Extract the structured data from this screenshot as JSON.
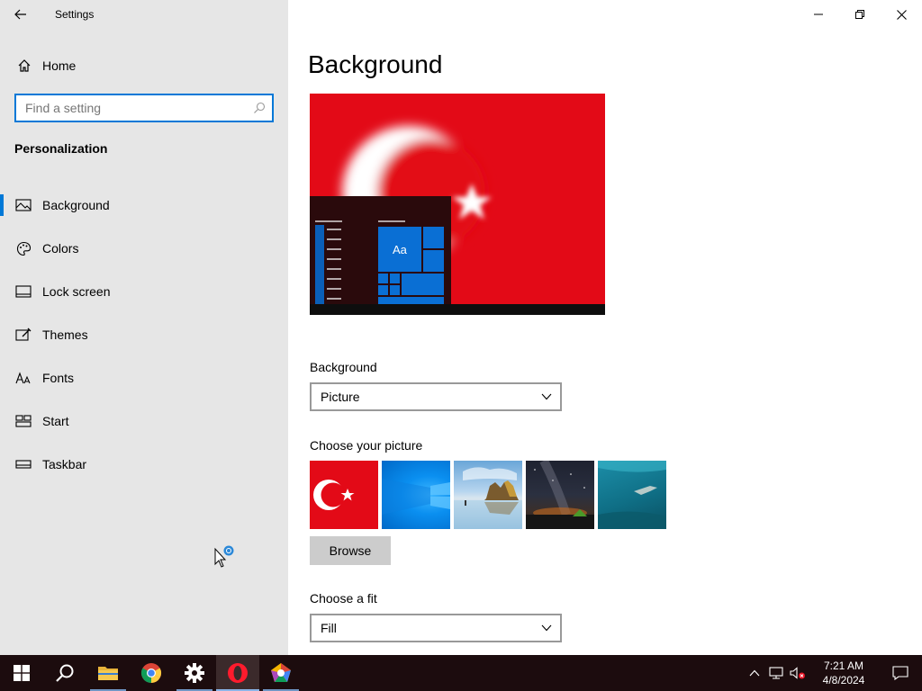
{
  "window": {
    "title": "Settings"
  },
  "sidebar": {
    "home_label": "Home",
    "search_placeholder": "Find a setting",
    "section_title": "Personalization",
    "items": [
      {
        "label": "Background",
        "icon": "picture-icon",
        "active": true
      },
      {
        "label": "Colors",
        "icon": "palette-icon",
        "active": false
      },
      {
        "label": "Lock screen",
        "icon": "lock-screen-icon",
        "active": false
      },
      {
        "label": "Themes",
        "icon": "themes-icon",
        "active": false
      },
      {
        "label": "Fonts",
        "icon": "fonts-icon",
        "active": false
      },
      {
        "label": "Start",
        "icon": "start-icon",
        "active": false
      },
      {
        "label": "Taskbar",
        "icon": "taskbar-icon",
        "active": false
      }
    ]
  },
  "main": {
    "page_title": "Background",
    "preview": {
      "tile_label": "Aa"
    },
    "background_label": "Background",
    "background_value": "Picture",
    "choose_picture_label": "Choose your picture",
    "pictures": [
      "turkish-flag",
      "windows-blue",
      "beach-rocks",
      "night-sky",
      "underwater"
    ],
    "browse_label": "Browse",
    "fit_label": "Choose a fit",
    "fit_value": "Fill"
  },
  "taskbar": {
    "apps": [
      "start-icon",
      "search-icon",
      "file-explorer-icon",
      "chrome-icon",
      "settings-icon",
      "opera-icon",
      "app-icon"
    ],
    "clock_time": "7:21 AM",
    "clock_date": "4/8/2024"
  },
  "colors": {
    "accent": "#0078d7",
    "flag_red": "#e30a17",
    "taskbar_bg": "#1c0c0e",
    "sidebar_bg": "#e6e6e6"
  }
}
